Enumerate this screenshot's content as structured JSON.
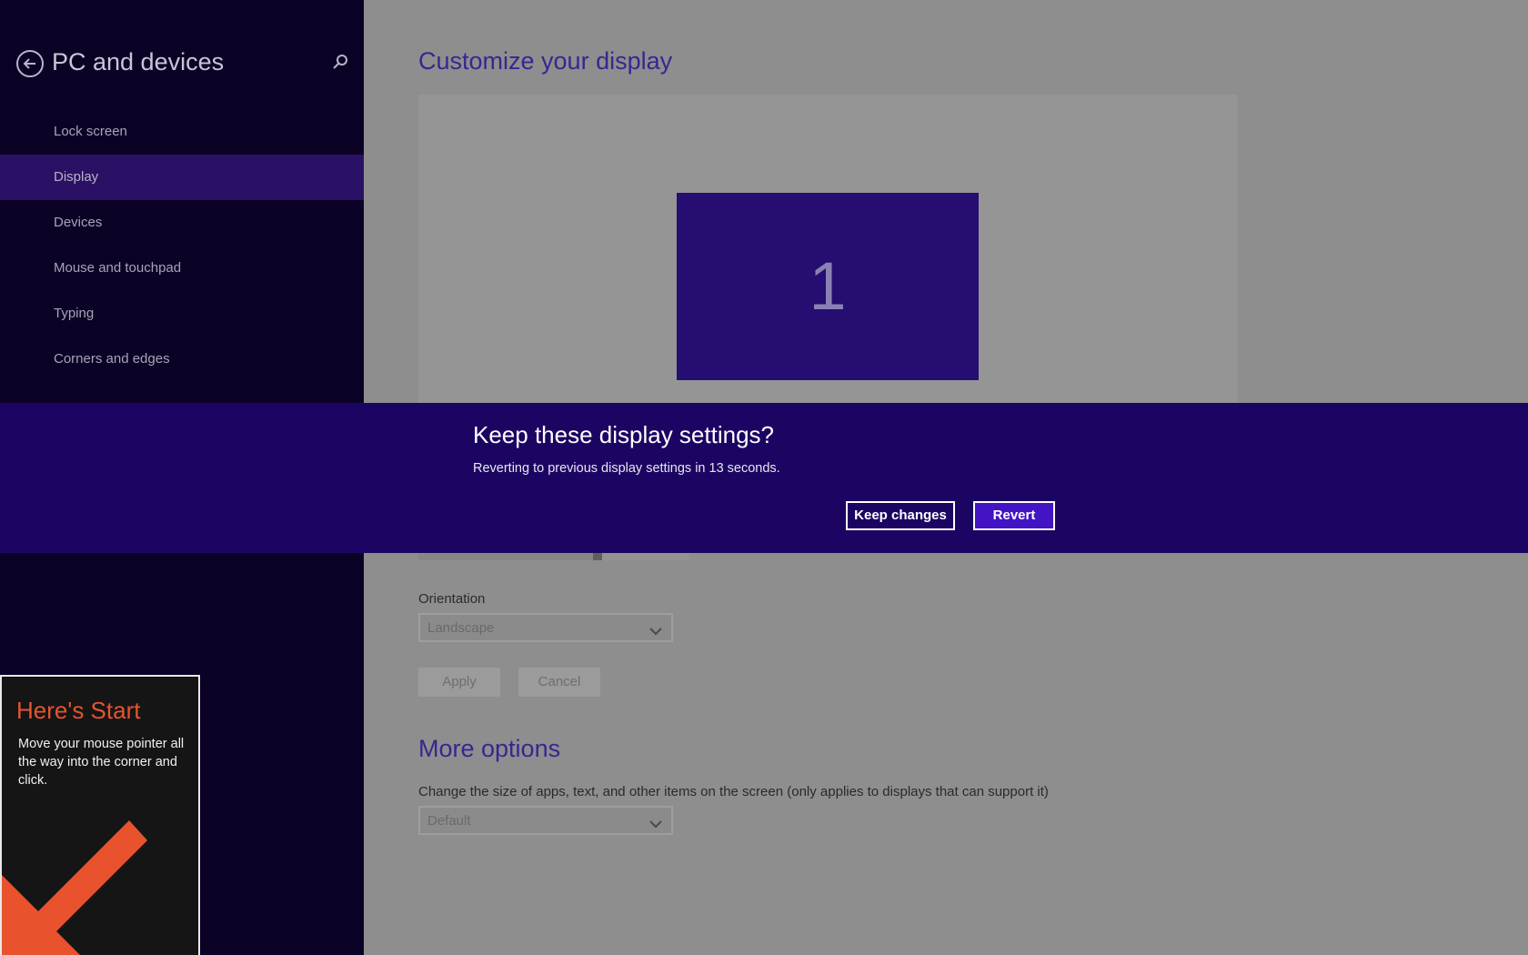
{
  "sidebar": {
    "title": "PC and devices",
    "back_icon": "back-arrow-icon",
    "search_icon": "search-icon",
    "items": [
      {
        "label": "Lock screen",
        "selected": false
      },
      {
        "label": "Display",
        "selected": true
      },
      {
        "label": "Devices",
        "selected": false
      },
      {
        "label": "Mouse and touchpad",
        "selected": false
      },
      {
        "label": "Typing",
        "selected": false
      },
      {
        "label": "Corners and edges",
        "selected": false
      }
    ]
  },
  "main": {
    "title": "Customize your display",
    "monitor_number": "1",
    "resolution_level": 0.66,
    "orientation_label": "Orientation",
    "orientation_value": "Landscape",
    "apply_label": "Apply",
    "cancel_label": "Cancel",
    "more_options_title": "More options",
    "size_label": "Change the size of apps, text, and other items on the screen (only applies to displays that can support it)",
    "size_value": "Default"
  },
  "dialog": {
    "title": "Keep these display settings?",
    "message": "Reverting to previous display settings in 13 seconds.",
    "keep_label": "Keep changes",
    "revert_label": "Revert"
  },
  "start_tip": {
    "title": "Here's Start",
    "body": "Move your mouse pointer all the way into the corner and click."
  },
  "colors": {
    "accent": "#4314c4",
    "banner": "#1c0562",
    "sidebar_bg": "#0c0226",
    "start_tip_accent": "#e8532e"
  }
}
